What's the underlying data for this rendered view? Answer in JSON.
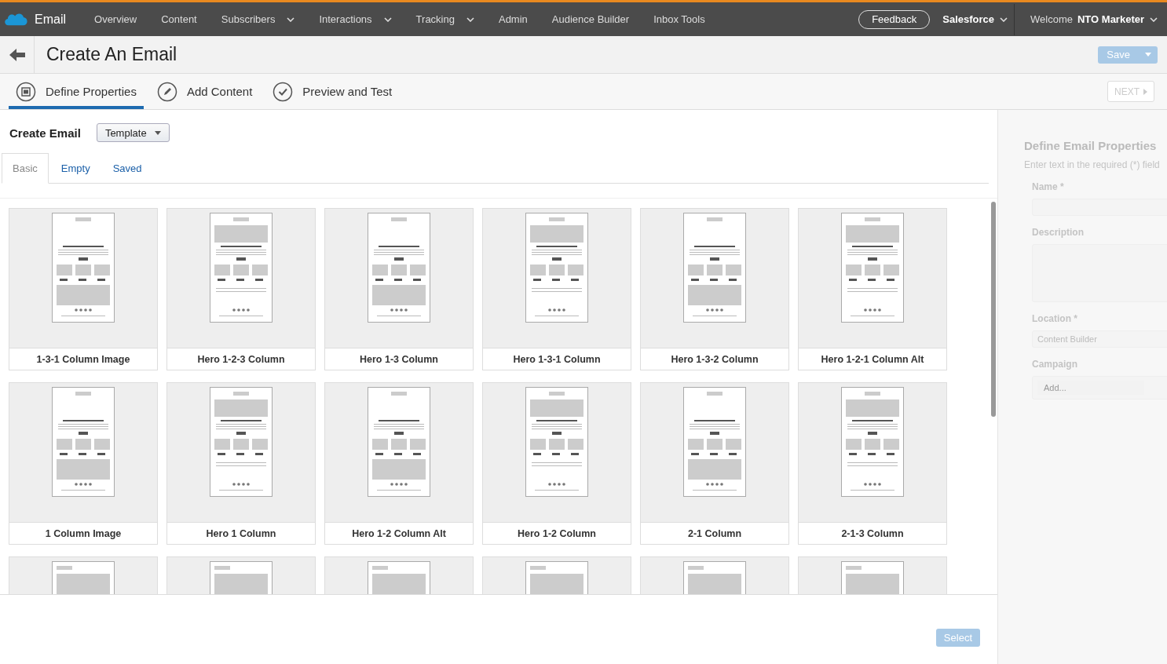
{
  "topbar": {
    "app": "Email",
    "nav": [
      {
        "label": "Overview",
        "dropdown": false
      },
      {
        "label": "Content",
        "dropdown": false
      },
      {
        "label": "Subscribers",
        "dropdown": true
      },
      {
        "label": "Interactions",
        "dropdown": true
      },
      {
        "label": "Tracking",
        "dropdown": true
      },
      {
        "label": "Admin",
        "dropdown": false
      },
      {
        "label": "Audience Builder",
        "dropdown": false
      },
      {
        "label": "Inbox Tools",
        "dropdown": false
      }
    ],
    "feedback": "Feedback",
    "account": "Salesforce",
    "welcome": "Welcome",
    "user": "NTO Marketer"
  },
  "header": {
    "title": "Create An Email",
    "save": "Save",
    "save_disabled": true
  },
  "steps": [
    {
      "label": "Define Properties",
      "selected": true
    },
    {
      "label": "Add Content",
      "selected": false
    },
    {
      "label": "Preview and Test",
      "selected": false
    }
  ],
  "next": {
    "label": "NEXT",
    "disabled": true
  },
  "create": {
    "label": "Create Email",
    "dropdown": "Template"
  },
  "tabs": [
    {
      "label": "Basic",
      "selected": true
    },
    {
      "label": "Empty",
      "selected": false
    },
    {
      "label": "Saved",
      "selected": false
    }
  ],
  "templates": [
    {
      "kind": "card",
      "name": "1-3-1 Column Image"
    },
    {
      "kind": "card",
      "name": "Hero 1-2-3 Column"
    },
    {
      "kind": "card",
      "name": "Hero 1-3 Column"
    },
    {
      "kind": "card",
      "name": "Hero 1-3-1 Column"
    },
    {
      "kind": "card",
      "name": "Hero 1-3-2 Column"
    },
    {
      "kind": "card",
      "name": "Hero 1-2-1 Column Alt"
    },
    {
      "kind": "card",
      "name": "1 Column Image"
    },
    {
      "kind": "card",
      "name": "Hero 1 Column"
    },
    {
      "kind": "card",
      "name": "Hero 1-2 Column Alt"
    },
    {
      "kind": "card",
      "name": "Hero 1-2 Column"
    },
    {
      "kind": "card",
      "name": "2-1 Column"
    },
    {
      "kind": "card",
      "name": "2-1-3 Column"
    },
    {
      "kind": "partial"
    },
    {
      "kind": "partial"
    },
    {
      "kind": "partial"
    },
    {
      "kind": "partial"
    },
    {
      "kind": "partial"
    },
    {
      "kind": "partial"
    }
  ],
  "select": {
    "label": "Select",
    "disabled": true
  },
  "panel": {
    "title": "Define Email Properties",
    "hint": "Enter text in the required (*) field",
    "fields": [
      {
        "label": "Name *",
        "kind": "input"
      },
      {
        "label": "Description",
        "kind": "textarea"
      },
      {
        "label": "Location *",
        "kind": "input",
        "value": "Content Builder"
      },
      {
        "label": "Campaign",
        "kind": "tags",
        "placeholder": "Add..."
      }
    ]
  }
}
